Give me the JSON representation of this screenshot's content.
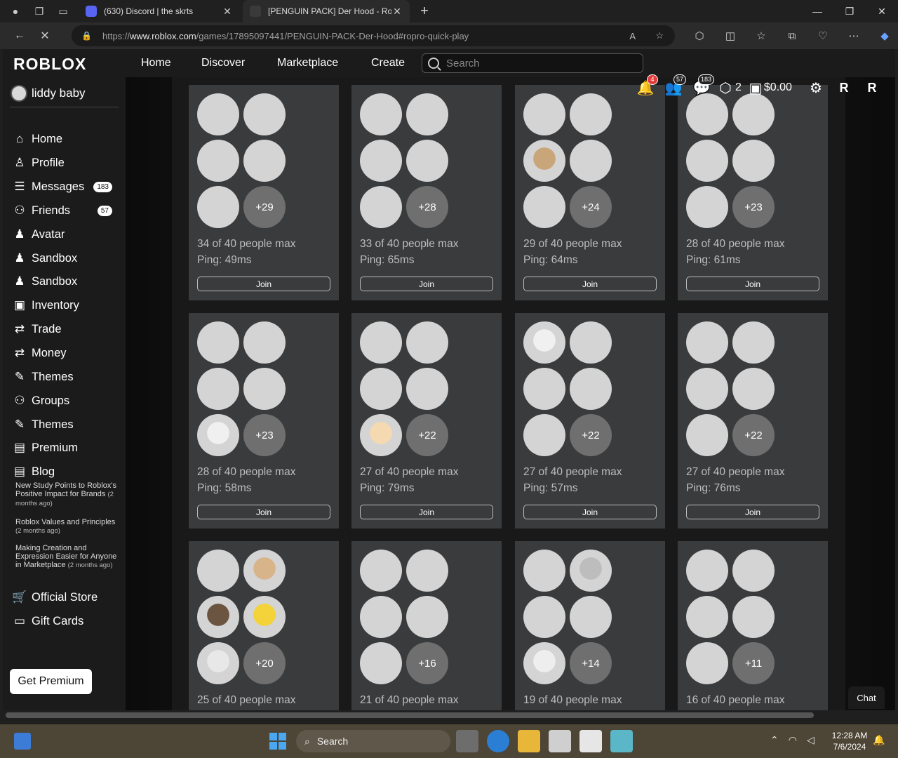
{
  "browser": {
    "tabs": [
      {
        "title": "(630) Discord | the skrts",
        "active": false
      },
      {
        "title": "[PENGUIN PACK] Der Hood - Rol",
        "active": true
      }
    ],
    "url_prefix": "https://",
    "url_host": "www.roblox.com",
    "url_path": "/games/17895097441/PENGUIN-PACK-Der-Hood#ropro-quick-play"
  },
  "header": {
    "logo": "ROBLOX",
    "nav": [
      "Home",
      "Discover",
      "Marketplace",
      "Create"
    ],
    "search_placeholder": "Search",
    "notifications_badge": "4",
    "friends_badge": "57",
    "messages_badge": "183",
    "robux": "2",
    "balance": "$0.00"
  },
  "sidebar": {
    "username": "liddy baby",
    "items": [
      {
        "label": "Home",
        "icon": "home-icon"
      },
      {
        "label": "Profile",
        "icon": "person-icon"
      },
      {
        "label": "Messages",
        "icon": "messages-icon",
        "badge": "183"
      },
      {
        "label": "Friends",
        "icon": "friends-icon",
        "badge": "57"
      },
      {
        "label": "Avatar",
        "icon": "avatar-icon"
      },
      {
        "label": "Sandbox",
        "icon": "sandbox-icon"
      },
      {
        "label": "Sandbox",
        "icon": "sandbox-icon"
      },
      {
        "label": "Inventory",
        "icon": "inventory-icon"
      },
      {
        "label": "Trade",
        "icon": "trade-icon"
      },
      {
        "label": "Money",
        "icon": "money-icon"
      },
      {
        "label": "Themes",
        "icon": "themes-icon"
      },
      {
        "label": "Groups",
        "icon": "groups-icon"
      },
      {
        "label": "Themes",
        "icon": "themes-icon"
      },
      {
        "label": "Premium",
        "icon": "premium-icon"
      },
      {
        "label": "Blog",
        "icon": "blog-icon"
      }
    ],
    "blog_posts": [
      {
        "title": "New Study Points to Roblox's Positive Impact for Brands",
        "ago": "(2 months ago)"
      },
      {
        "title": "Roblox Values and Principles",
        "ago": "(2 months ago)"
      },
      {
        "title": "Making Creation and Expression Easier for Anyone in Marketplace",
        "ago": "(2 months ago)"
      }
    ],
    "store_items": [
      {
        "label": "Official Store",
        "icon": "cart-icon"
      },
      {
        "label": "Gift Cards",
        "icon": "gift-card-icon"
      }
    ],
    "get_premium": "Get Premium"
  },
  "servers": [
    {
      "more": "+29",
      "players": "34 of 40 people max",
      "ping": "Ping: 49ms",
      "join": "Join"
    },
    {
      "more": "+28",
      "players": "33 of 40 people max",
      "ping": "Ping: 65ms",
      "join": "Join"
    },
    {
      "more": "+24",
      "players": "29 of 40 people max",
      "ping": "Ping: 64ms",
      "join": "Join"
    },
    {
      "more": "+23",
      "players": "28 of 40 people max",
      "ping": "Ping: 61ms",
      "join": "Join"
    },
    {
      "more": "+23",
      "players": "28 of 40 people max",
      "ping": "Ping: 58ms",
      "join": "Join"
    },
    {
      "more": "+22",
      "players": "27 of 40 people max",
      "ping": "Ping: 79ms",
      "join": "Join"
    },
    {
      "more": "+22",
      "players": "27 of 40 people max",
      "ping": "Ping: 57ms",
      "join": "Join"
    },
    {
      "more": "+22",
      "players": "27 of 40 people max",
      "ping": "Ping: 76ms",
      "join": "Join"
    },
    {
      "more": "+20",
      "players": "25 of 40 people max",
      "ping": "",
      "join": ""
    },
    {
      "more": "+16",
      "players": "21 of 40 people max",
      "ping": "",
      "join": ""
    },
    {
      "more": "+14",
      "players": "19 of 40 people max",
      "ping": "",
      "join": ""
    },
    {
      "more": "+11",
      "players": "16 of 40 people max",
      "ping": "",
      "join": ""
    }
  ],
  "chat_label": "Chat",
  "taskbar": {
    "search": "Search",
    "time": "12:28 AM",
    "date": "7/6/2024"
  }
}
